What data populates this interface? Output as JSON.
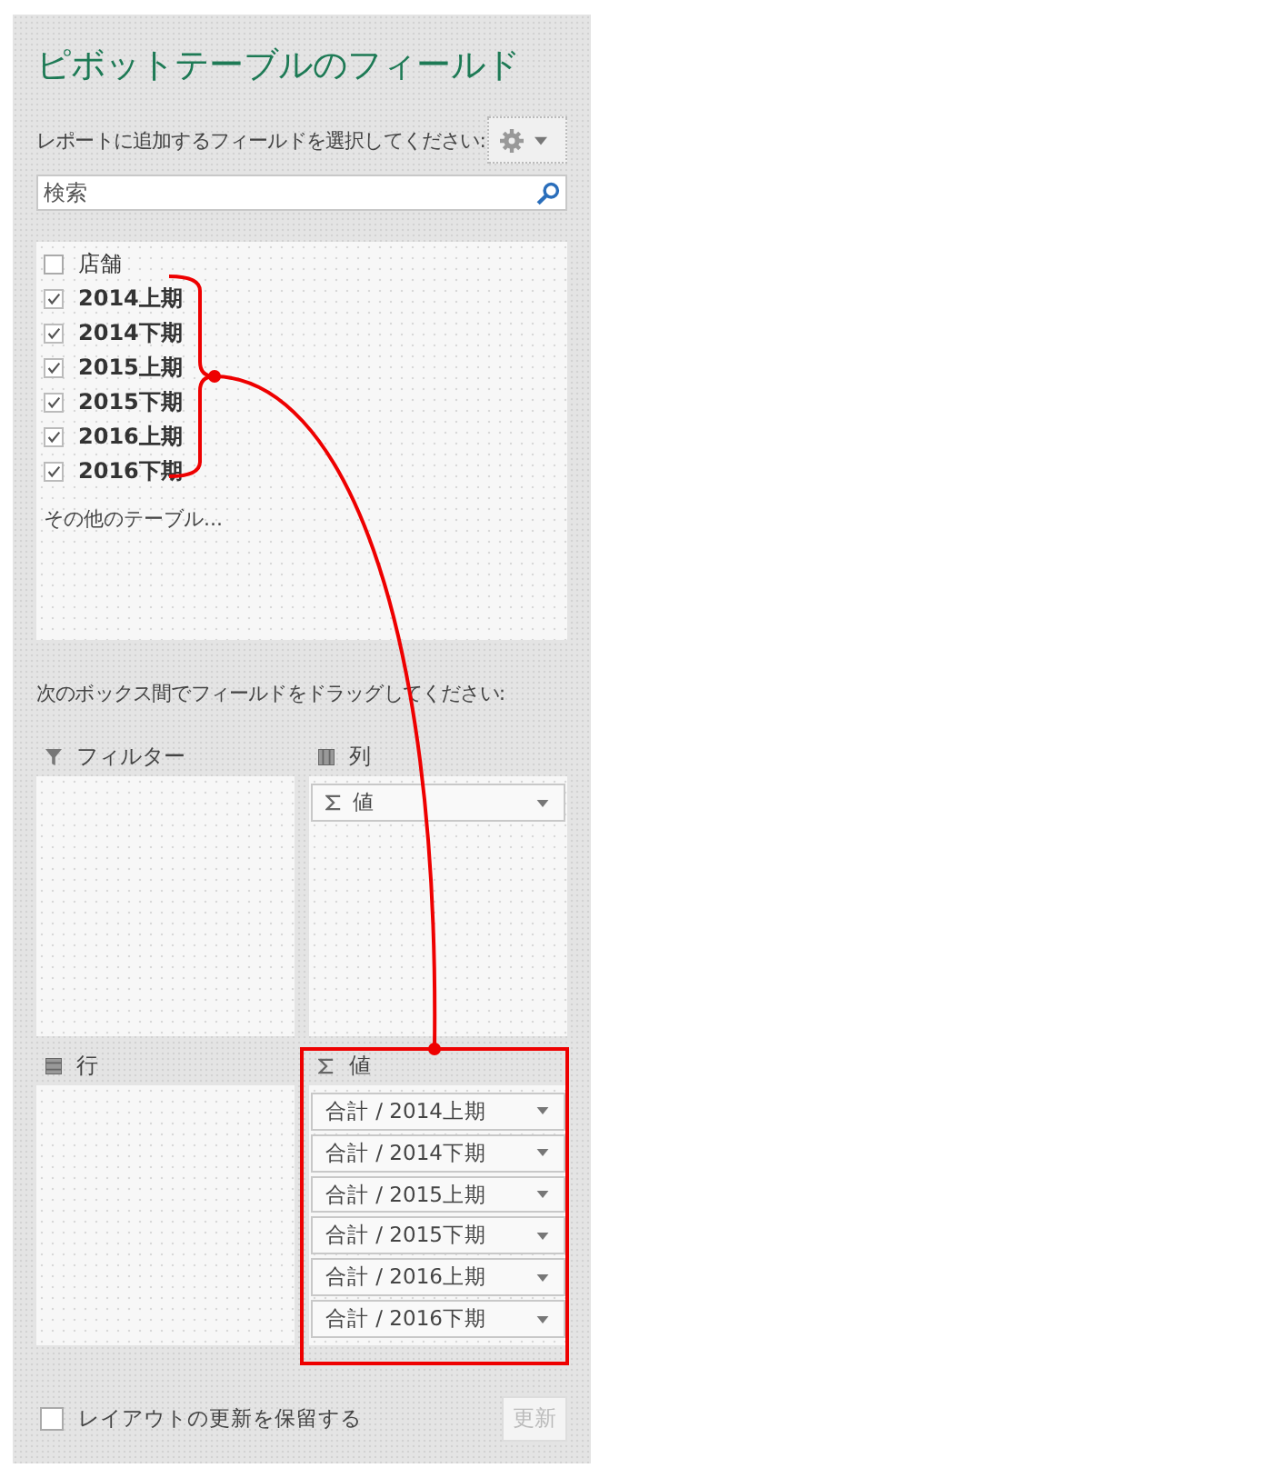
{
  "panel": {
    "title": "ピボットテーブルのフィールド",
    "subtitle": "レポートに追加するフィールドを選択してください:",
    "search": {
      "placeholder": "検索"
    },
    "fields": [
      {
        "label": "店舗",
        "checked": false
      },
      {
        "label": "2014上期",
        "checked": true
      },
      {
        "label": "2014下期",
        "checked": true
      },
      {
        "label": "2015上期",
        "checked": true
      },
      {
        "label": "2015下期",
        "checked": true
      },
      {
        "label": "2016上期",
        "checked": true
      },
      {
        "label": "2016下期",
        "checked": true
      }
    ],
    "more_tables": "その他のテーブル...",
    "drag_hint": "次のボックス間でフィールドをドラッグしてください:",
    "areas": [
      {
        "kind": "filter",
        "label": "フィルター"
      },
      {
        "kind": "columns",
        "label": "列",
        "items": [
          {
            "kind": "values",
            "label": "値"
          }
        ]
      },
      {
        "kind": "rows",
        "label": "行"
      },
      {
        "kind": "values",
        "label": "値",
        "items": [
          {
            "kind": "field",
            "label": "合計 / 2014上期"
          },
          {
            "kind": "field",
            "label": "合計 / 2014下期"
          },
          {
            "kind": "field",
            "label": "合計 / 2015上期"
          },
          {
            "kind": "field",
            "label": "合計 / 2015下期"
          },
          {
            "kind": "field",
            "label": "合計 / 2016上期"
          },
          {
            "kind": "field",
            "label": "合計 / 2016下期"
          }
        ]
      }
    ],
    "defer_update": {
      "label": "レイアウトの更新を保留する",
      "checked": false
    },
    "update_button": {
      "label": "更新",
      "disabled": true
    }
  }
}
